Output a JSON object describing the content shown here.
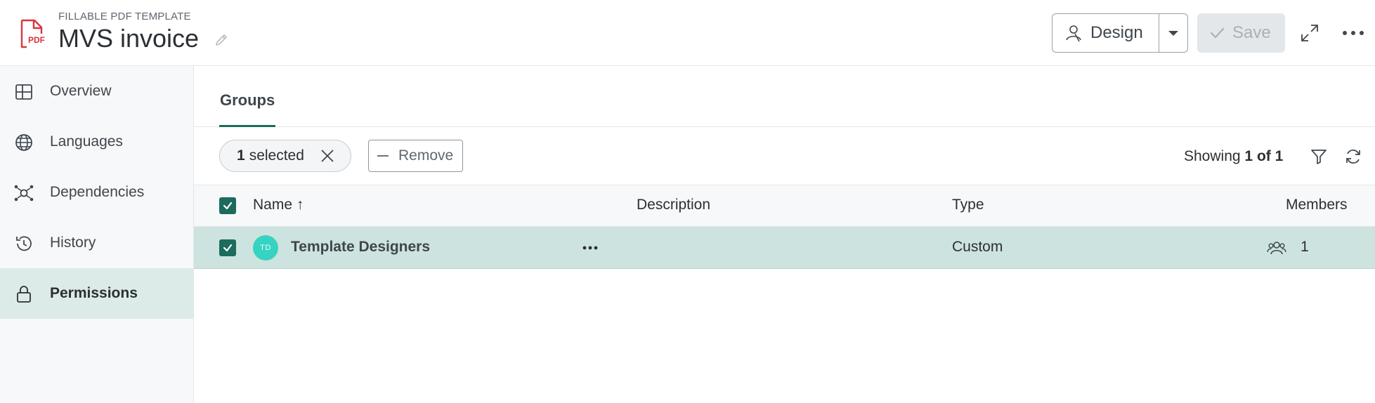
{
  "header": {
    "doc_type": "FILLABLE PDF TEMPLATE",
    "title": "MVS invoice",
    "pdf_icon_label": "PDF",
    "design_label": "Design",
    "save_label": "Save"
  },
  "sidebar": {
    "items": [
      {
        "label": "Overview",
        "icon": "grid-icon",
        "active": false
      },
      {
        "label": "Languages",
        "icon": "globe-icon",
        "active": false
      },
      {
        "label": "Dependencies",
        "icon": "network-icon",
        "active": false
      },
      {
        "label": "History",
        "icon": "history-icon",
        "active": false
      },
      {
        "label": "Permissions",
        "icon": "lock-icon",
        "active": true
      }
    ]
  },
  "main": {
    "tabs": [
      {
        "label": "Groups",
        "active": true
      }
    ],
    "toolbar": {
      "selected_count": "1",
      "selected_text": "selected",
      "remove_label": "Remove",
      "showing_prefix": "Showing",
      "showing_current": "1",
      "showing_of": "of",
      "showing_total": "1"
    },
    "table": {
      "columns": {
        "name": "Name",
        "name_sort": "↑",
        "description": "Description",
        "type": "Type",
        "members": "Members"
      },
      "rows": [
        {
          "initials": "TD",
          "name": "Template Designers",
          "description": "",
          "type": "Custom",
          "members": "1",
          "selected": true
        }
      ]
    }
  },
  "colors": {
    "accent": "#1c6b5c",
    "selected_row": "#cde3df",
    "active_nav": "#dcebe8",
    "avatar": "#36d3c2",
    "pdf_red": "#d9343f"
  }
}
